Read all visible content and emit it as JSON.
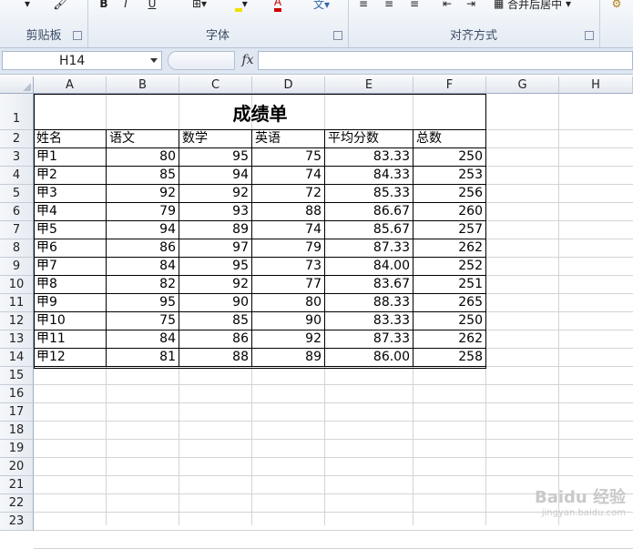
{
  "ribbon": {
    "groups": [
      {
        "label": "剪贴板"
      },
      {
        "label": "字体"
      },
      {
        "label": "对齐方式"
      }
    ],
    "merge_label": "合并后居中",
    "bold_label": "B",
    "italic_label": "I",
    "underline_label": "U",
    "font_color_label": "A"
  },
  "formula_bar": {
    "name_box": "H14",
    "fx_label": "fx",
    "formula": ""
  },
  "sheet": {
    "columns": [
      "A",
      "B",
      "C",
      "D",
      "E",
      "F",
      "G",
      "H"
    ],
    "rows": [
      "1",
      "2",
      "3",
      "4",
      "5",
      "6",
      "7",
      "8",
      "9",
      "10",
      "11",
      "12",
      "13",
      "14",
      "15",
      "16",
      "17",
      "18",
      "19",
      "20",
      "21",
      "22",
      "23"
    ],
    "title": "成绩单",
    "headers": [
      "姓名",
      "语文",
      "数学",
      "英语",
      "平均分数",
      "总数"
    ],
    "data": [
      [
        "甲1",
        "80",
        "95",
        "75",
        "83.33",
        "250"
      ],
      [
        "甲2",
        "85",
        "94",
        "74",
        "84.33",
        "253"
      ],
      [
        "甲3",
        "92",
        "92",
        "72",
        "85.33",
        "256"
      ],
      [
        "甲4",
        "79",
        "93",
        "88",
        "86.67",
        "260"
      ],
      [
        "甲5",
        "94",
        "89",
        "74",
        "85.67",
        "257"
      ],
      [
        "甲6",
        "86",
        "97",
        "79",
        "87.33",
        "262"
      ],
      [
        "甲7",
        "84",
        "95",
        "73",
        "84.00",
        "252"
      ],
      [
        "甲8",
        "82",
        "92",
        "77",
        "83.67",
        "251"
      ],
      [
        "甲9",
        "95",
        "90",
        "80",
        "88.33",
        "265"
      ],
      [
        "甲10",
        "75",
        "85",
        "90",
        "83.33",
        "250"
      ],
      [
        "甲11",
        "84",
        "86",
        "92",
        "87.33",
        "262"
      ],
      [
        "甲12",
        "81",
        "88",
        "89",
        "86.00",
        "258"
      ]
    ]
  },
  "watermark": {
    "text": "Baidu 经验",
    "sub": "jingyan.baidu.com"
  }
}
